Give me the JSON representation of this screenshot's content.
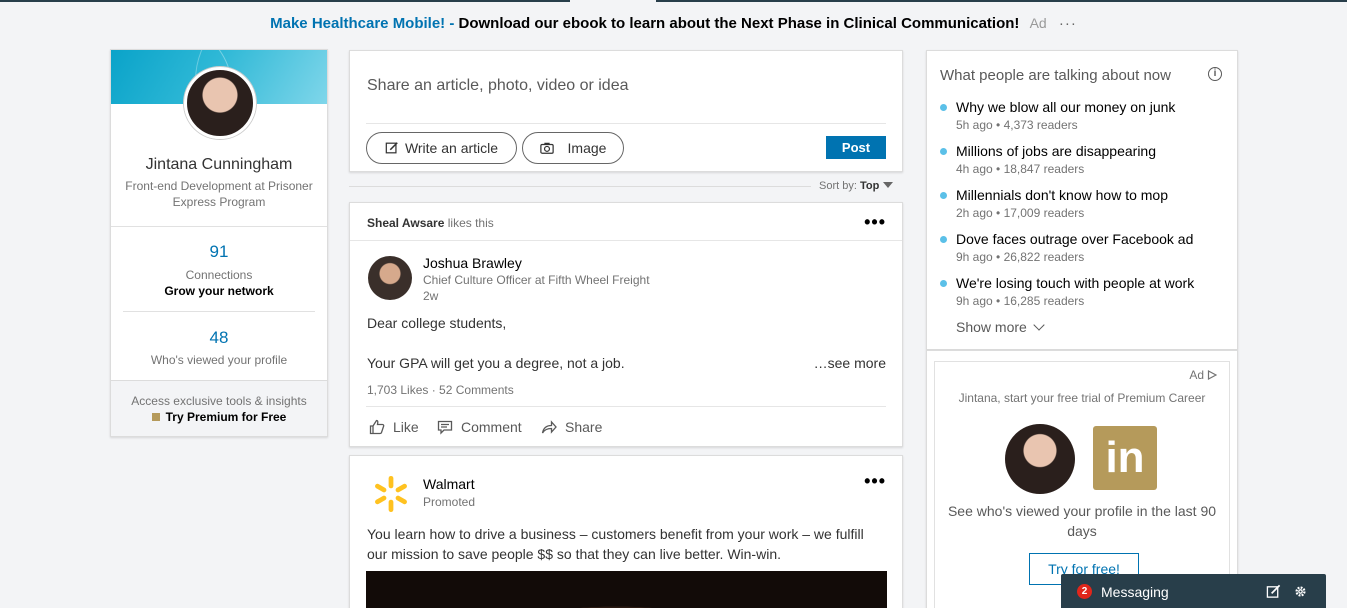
{
  "ad_banner": {
    "link": "Make Healthcare Mobile! -",
    "text": "Download our ebook to learn about the Next Phase in Clinical Communication!",
    "tag": "Ad",
    "menu": "···"
  },
  "profile": {
    "name": "Jintana Cunningham",
    "title": "Front-end Development at Prisoner Express Program",
    "connections_count": "91",
    "connections_label": "Connections",
    "grow_label": "Grow your network",
    "views_count": "48",
    "views_label": "Who's viewed your profile",
    "premium_line1": "Access exclusive tools & insights",
    "premium_line2": "Try Premium for Free"
  },
  "share": {
    "prompt": "Share an article, photo, video or idea",
    "write_label": "Write an article",
    "image_label": "Image",
    "post_label": "Post"
  },
  "sort": {
    "label": "Sort by:",
    "value": "Top"
  },
  "post1": {
    "actor": "Sheal Awsare",
    "activity": "likes this",
    "author_name": "Joshua Brawley",
    "author_title": "Chief Culture Officer at Fifth Wheel Freight",
    "time": "2w",
    "line1": "Dear college students,",
    "line2": "Your GPA will get you a degree, not a job.",
    "see_more": "…see more",
    "counts": "1,703 Likes · 52 Comments",
    "like_label": "Like",
    "comment_label": "Comment",
    "share_label": "Share"
  },
  "post2": {
    "author_name": "Walmart",
    "author_sub": "Promoted",
    "line1": "You learn how to drive a business – customers benefit from your work – we fulfill",
    "line2": "our mission to save people $$ so that they can live better. Win-win."
  },
  "news": {
    "title": "What people are talking about now",
    "info_icon": "i",
    "items": [
      {
        "headline": "Why we blow all our money on junk",
        "meta": "5h ago • 4,373 readers"
      },
      {
        "headline": "Millions of jobs are disappearing",
        "meta": "4h ago • 18,847 readers"
      },
      {
        "headline": "Millennials don't know how to mop",
        "meta": "2h ago • 17,009 readers"
      },
      {
        "headline": "Dove faces outrage over Facebook ad",
        "meta": "9h ago • 26,822 readers"
      },
      {
        "headline": "We're losing touch with people at work",
        "meta": "9h ago • 16,285 readers"
      }
    ],
    "show_more": "Show more"
  },
  "sidebar_ad": {
    "tag": "Ad",
    "line1": "Jintana, start your free trial of Premium Career",
    "logo_text": "in",
    "line2": "See who's viewed your profile in the last 90 days",
    "cta": "Try for free!"
  },
  "messaging": {
    "badge": "2",
    "label": "Messaging"
  },
  "colors": {
    "accent": "#0073b1",
    "premium_gold": "#b59a5b",
    "news_dot": "#5bc0e8",
    "messaging_bar": "#283e4a",
    "badge_red": "#e0261b"
  }
}
